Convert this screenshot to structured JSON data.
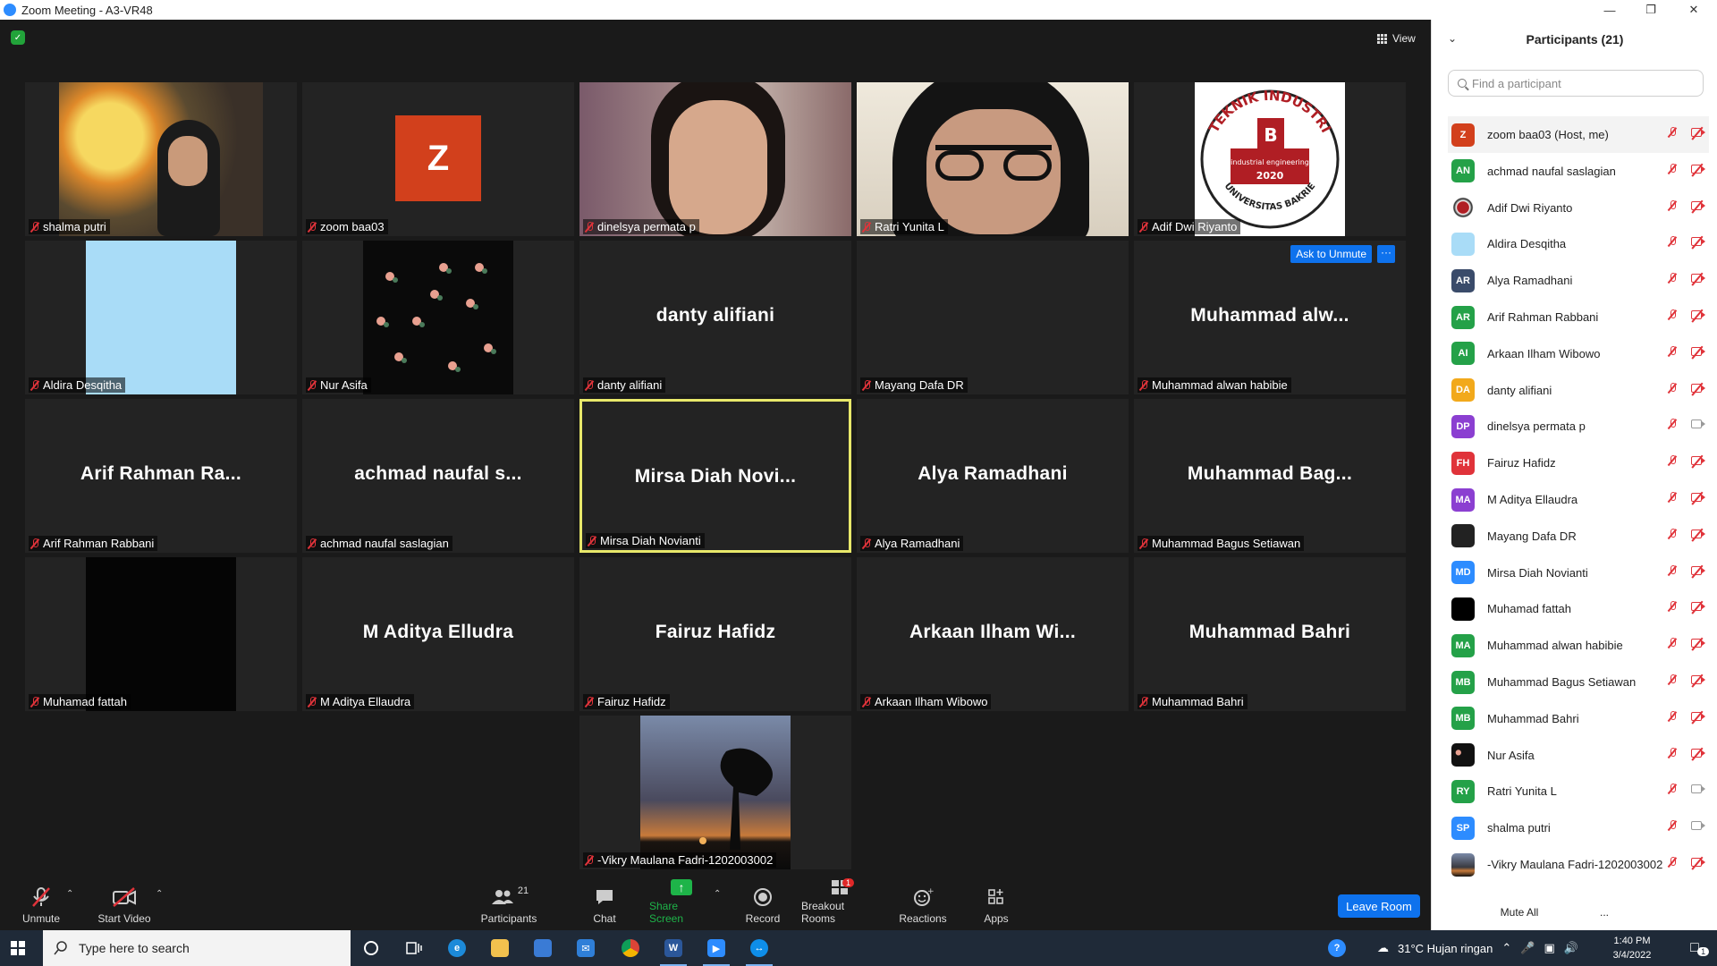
{
  "window": {
    "title": "Zoom Meeting - A3-VR48"
  },
  "meeting": {
    "view_label": "View",
    "tiles": [
      {
        "label": "shalma putri",
        "big": "",
        "kind": "video",
        "media": "room-lamp"
      },
      {
        "label": "zoom baa03",
        "big": "Z",
        "kind": "avatar",
        "media": ""
      },
      {
        "label": "dinelsya permata p",
        "big": "",
        "kind": "video",
        "media": "face"
      },
      {
        "label": "Ratri Yunita L",
        "big": "",
        "kind": "video",
        "media": "glasses"
      },
      {
        "label": "Adif Dwi Riyanto",
        "big": "",
        "kind": "image",
        "media": "logo"
      },
      {
        "label": "Aldira Desqitha",
        "big": "",
        "kind": "image",
        "media": "lightblue"
      },
      {
        "label": "Nur Asifa",
        "big": "",
        "kind": "image",
        "media": "flowers"
      },
      {
        "label": "danty alifiani",
        "big": "danty alifiani",
        "kind": "name",
        "media": ""
      },
      {
        "label": "Mayang Dafa DR",
        "big": "",
        "kind": "dark",
        "media": ""
      },
      {
        "label": "Muhammad alwan habibie",
        "big": "Muhammad alw...",
        "kind": "name",
        "media": ""
      },
      {
        "label": "Arif Rahman Rabbani",
        "big": "Arif Rahman Ra...",
        "kind": "name",
        "media": ""
      },
      {
        "label": "achmad naufal saslagian",
        "big": "achmad naufal s...",
        "kind": "name",
        "media": ""
      },
      {
        "label": "Mirsa Diah Novianti",
        "big": "Mirsa Diah Novi...",
        "kind": "name",
        "media": ""
      },
      {
        "label": "Alya Ramadhani",
        "big": "Alya Ramadhani",
        "kind": "name",
        "media": ""
      },
      {
        "label": "Muhammad Bagus Setiawan",
        "big": "Muhammad Bag...",
        "kind": "name",
        "media": ""
      },
      {
        "label": "Muhamad fattah",
        "big": "",
        "kind": "image",
        "media": "black"
      },
      {
        "label": "M Aditya Ellaudra",
        "big": "M Aditya Elludra",
        "kind": "name",
        "media": ""
      },
      {
        "label": "Fairuz Hafidz",
        "big": "Fairuz Hafidz",
        "kind": "name",
        "media": ""
      },
      {
        "label": "Arkaan Ilham Wibowo",
        "big": "Arkaan Ilham Wi...",
        "kind": "name",
        "media": ""
      },
      {
        "label": "Muhammad Bahri",
        "big": "Muhammad Bahri",
        "kind": "name",
        "media": ""
      },
      {
        "label": "-Vikry Maulana Fadri-1202003002",
        "big": "",
        "kind": "image",
        "media": "sunset"
      }
    ],
    "ask_unmute_label": "Ask to Unmute",
    "ask_unmute_more": "···",
    "logo_text": {
      "top": "TEKNIK INDUSTRI",
      "year": "2020",
      "bottom": "UNIVERSITAS BAKRIE",
      "sub": "industrial engineering"
    }
  },
  "toolbar": {
    "unmute": "Unmute",
    "start_video": "Start Video",
    "participants": "Participants",
    "participants_count": "21",
    "chat": "Chat",
    "share_screen": "Share Screen",
    "record": "Record",
    "breakout_rooms": "Breakout Rooms",
    "breakout_badge": "1",
    "reactions": "Reactions",
    "apps": "Apps",
    "leave": "Leave Room"
  },
  "panel": {
    "title": "Participants (21)",
    "search_placeholder": "Find a participant",
    "mute_all": "Mute All",
    "more": "...",
    "participants": [
      {
        "initials": "Z",
        "name": "zoom baa03 (Host, me)",
        "color": "#d2401c",
        "cam": "off"
      },
      {
        "initials": "AN",
        "name": "achmad naufal saslagian",
        "color": "#24a148",
        "cam": "off"
      },
      {
        "initials": "",
        "name": "Adif Dwi Riyanto",
        "color": "#ffffff",
        "cam": "off",
        "pic": "logo"
      },
      {
        "initials": "",
        "name": "Aldira Desqitha",
        "color": "#a9dcf7",
        "cam": "off"
      },
      {
        "initials": "AR",
        "name": "Alya Ramadhani",
        "color": "#3a4b6a",
        "cam": "off"
      },
      {
        "initials": "AR",
        "name": "Arif Rahman Rabbani",
        "color": "#24a148",
        "cam": "off"
      },
      {
        "initials": "AI",
        "name": "Arkaan Ilham Wibowo",
        "color": "#24a148",
        "cam": "off"
      },
      {
        "initials": "DA",
        "name": "danty alifiani",
        "color": "#f2a91b",
        "cam": "off"
      },
      {
        "initials": "DP",
        "name": "dinelsya permata p",
        "color": "#8b3fd1",
        "cam": "on"
      },
      {
        "initials": "FH",
        "name": "Fairuz Hafidz",
        "color": "#e0333a",
        "cam": "off"
      },
      {
        "initials": "MA",
        "name": "M Aditya Ellaudra",
        "color": "#8b3fd1",
        "cam": "off"
      },
      {
        "initials": "",
        "name": "Mayang Dafa DR",
        "color": "#222222",
        "cam": "off"
      },
      {
        "initials": "MD",
        "name": "Mirsa Diah Novianti",
        "color": "#2d8cff",
        "cam": "off"
      },
      {
        "initials": "",
        "name": "Muhamad fattah",
        "color": "#000000",
        "cam": "off"
      },
      {
        "initials": "MA",
        "name": "Muhammad alwan habibie",
        "color": "#24a148",
        "cam": "off"
      },
      {
        "initials": "MB",
        "name": "Muhammad Bagus Setiawan",
        "color": "#24a148",
        "cam": "off"
      },
      {
        "initials": "MB",
        "name": "Muhammad Bahri",
        "color": "#24a148",
        "cam": "off"
      },
      {
        "initials": "",
        "name": "Nur Asifa",
        "color": "#111111",
        "cam": "off",
        "pic": "flowers"
      },
      {
        "initials": "RY",
        "name": "Ratri Yunita L",
        "color": "#24a148",
        "cam": "on"
      },
      {
        "initials": "SP",
        "name": "shalma putri",
        "color": "#2d8cff",
        "cam": "on"
      },
      {
        "initials": "",
        "name": "-Vikry Maulana Fadri-1202003002",
        "color": "#555555",
        "cam": "off",
        "pic": "sunset"
      }
    ]
  },
  "taskbar": {
    "search_placeholder": "Type here to search",
    "weather": "31°C  Hujan ringan",
    "time": "1:40 PM",
    "date": "3/4/2022",
    "notification_count": "1"
  }
}
